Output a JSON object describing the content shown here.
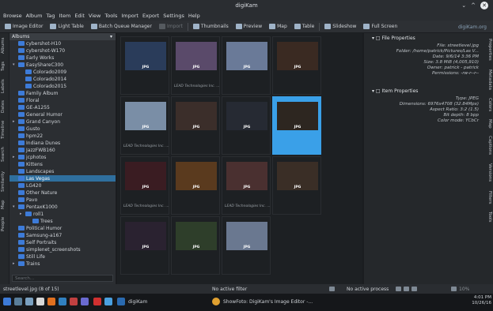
{
  "window": {
    "title": "digiKam",
    "minimize": "⌄",
    "maximize": "^",
    "close": "✕"
  },
  "menubar": [
    "Browse",
    "Album",
    "Tag",
    "Item",
    "Edit",
    "View",
    "Tools",
    "Import",
    "Export",
    "Settings",
    "Help"
  ],
  "toolbar": {
    "image_editor": "Image Editor",
    "light_table": "Light Table",
    "batch_queue": "Batch Queue Manager",
    "import": "Import",
    "thumbnails": "Thumbnails",
    "preview": "Preview",
    "map": "Map",
    "table": "Table",
    "slideshow": "Slideshow",
    "full_screen": "Full Screen",
    "brand": "digiKam.org"
  },
  "left_tabs": [
    "Albums",
    "Tags",
    "Labels",
    "Dates",
    "Timeline",
    "Search",
    "Similarity",
    "Map",
    "People"
  ],
  "albums": {
    "header": "Albums",
    "items": [
      {
        "label": "cybershot-H10",
        "depth": 1,
        "arrow": ""
      },
      {
        "label": "cybershot-W170",
        "depth": 1,
        "arrow": ""
      },
      {
        "label": "Early Works",
        "depth": 1,
        "arrow": ""
      },
      {
        "label": "EasyShareC300",
        "depth": 1,
        "arrow": "▾"
      },
      {
        "label": "Colorado2009",
        "depth": 2,
        "arrow": ""
      },
      {
        "label": "Colorado2014",
        "depth": 2,
        "arrow": ""
      },
      {
        "label": "Colorado2015",
        "depth": 2,
        "arrow": ""
      },
      {
        "label": "Family Album",
        "depth": 1,
        "arrow": ""
      },
      {
        "label": "Floral",
        "depth": 1,
        "arrow": ""
      },
      {
        "label": "GE-A1255",
        "depth": 1,
        "arrow": ""
      },
      {
        "label": "General Humor",
        "depth": 1,
        "arrow": ""
      },
      {
        "label": "Grand Canyon",
        "depth": 1,
        "arrow": "▸"
      },
      {
        "label": "Gusto",
        "depth": 1,
        "arrow": ""
      },
      {
        "label": "hpm22",
        "depth": 1,
        "arrow": ""
      },
      {
        "label": "Indiana Dunes",
        "depth": 1,
        "arrow": ""
      },
      {
        "label": "JazzFWB160",
        "depth": 1,
        "arrow": ""
      },
      {
        "label": "jcphotos",
        "depth": 1,
        "arrow": "▸"
      },
      {
        "label": "Kittens",
        "depth": 1,
        "arrow": ""
      },
      {
        "label": "Landscapes",
        "depth": 1,
        "arrow": ""
      },
      {
        "label": "Las Vegas",
        "depth": 1,
        "arrow": "",
        "selected": true
      },
      {
        "label": "LG420",
        "depth": 1,
        "arrow": ""
      },
      {
        "label": "Other Nature",
        "depth": 1,
        "arrow": ""
      },
      {
        "label": "Pavo",
        "depth": 1,
        "arrow": ""
      },
      {
        "label": "PentaxK1000",
        "depth": 1,
        "arrow": "▾"
      },
      {
        "label": "roll1",
        "depth": 2,
        "arrow": "▸"
      },
      {
        "label": "Trees",
        "depth": 3,
        "arrow": ""
      },
      {
        "label": "Political Humor",
        "depth": 1,
        "arrow": ""
      },
      {
        "label": "Samsung-a167",
        "depth": 1,
        "arrow": ""
      },
      {
        "label": "Self Portraits",
        "depth": 1,
        "arrow": ""
      },
      {
        "label": "simplenet_screenshots",
        "depth": 1,
        "arrow": ""
      },
      {
        "label": "Still Life",
        "depth": 1,
        "arrow": ""
      },
      {
        "label": "Trains",
        "depth": 1,
        "arrow": "▸"
      }
    ],
    "search_placeholder": "Search..."
  },
  "thumbnails": [
    {
      "label": "JPG",
      "caption": "",
      "color": "#2a3c5a",
      "selected": false
    },
    {
      "label": "JPG",
      "caption": "LEAD Technologies Inc. ...",
      "color": "#5a4a6a",
      "selected": false
    },
    {
      "label": "JPG",
      "caption": "",
      "color": "#6a7a98",
      "selected": false
    },
    {
      "label": "JPG",
      "caption": "",
      "color": "#3a2a22",
      "selected": false
    },
    {
      "label": "JPG",
      "caption": "LEAD Technologies Inc. ...",
      "color": "#7a8ea6",
      "selected": false
    },
    {
      "label": "JPG",
      "caption": "",
      "color": "#3b2e2a",
      "selected": false
    },
    {
      "label": "JPG",
      "caption": "",
      "color": "#262a33",
      "selected": false
    },
    {
      "label": "JPG",
      "caption": "",
      "color": "#2d2620",
      "selected": true
    },
    {
      "label": "JPG",
      "caption": "LEAD Technologies Inc. ...",
      "color": "#3a1c22",
      "selected": false
    },
    {
      "label": "JPG",
      "caption": "",
      "color": "#5a3a1e",
      "selected": false
    },
    {
      "label": "JPG",
      "caption": "LEAD Technologies Inc. ...",
      "color": "#4a3030",
      "selected": false
    },
    {
      "label": "JPG",
      "caption": "",
      "color": "#3a2e26",
      "selected": false
    },
    {
      "label": "JPG",
      "caption": "",
      "color": "#2a2230",
      "selected": false
    },
    {
      "label": "JPG",
      "caption": "",
      "color": "#2e3e2a",
      "selected": false
    },
    {
      "label": "JPG",
      "caption": "",
      "color": "#6a7890",
      "selected": false
    }
  ],
  "properties": {
    "file_header": "File Properties",
    "file": [
      "File: streetlevel.jpg",
      "Folder: /home/patrick/Pictures/Las V...",
      "Date: 9/6/14 3:36 PM",
      "Size: 3.8 MiB (4,005,910)",
      "Owner: patrick - patrick",
      "Permissions: -rw-r--r--"
    ],
    "item_header": "Item Properties",
    "item": [
      "Type: JPEG",
      "Dimensions: 6976x4708 (32.84Mpx)",
      "Aspect Ratio: 3:2 (1.5)",
      "Bit depth: 8 bpp",
      "Color mode: YCbCr"
    ]
  },
  "right_tabs": [
    "Properties",
    "Metadata",
    "Colors",
    "Map",
    "Captions",
    "Versions",
    "Filters",
    "Tools"
  ],
  "status": {
    "left": "streetlevel.jpg (8 of 15)",
    "filter": "No active filter",
    "process": "No active process",
    "zoom": "10%"
  },
  "taskbar": {
    "app1": "digiKam",
    "app2": "ShowFoto: DigiKam's Image Editor -...",
    "time": "4:01 PM",
    "date": "10/26/16"
  }
}
